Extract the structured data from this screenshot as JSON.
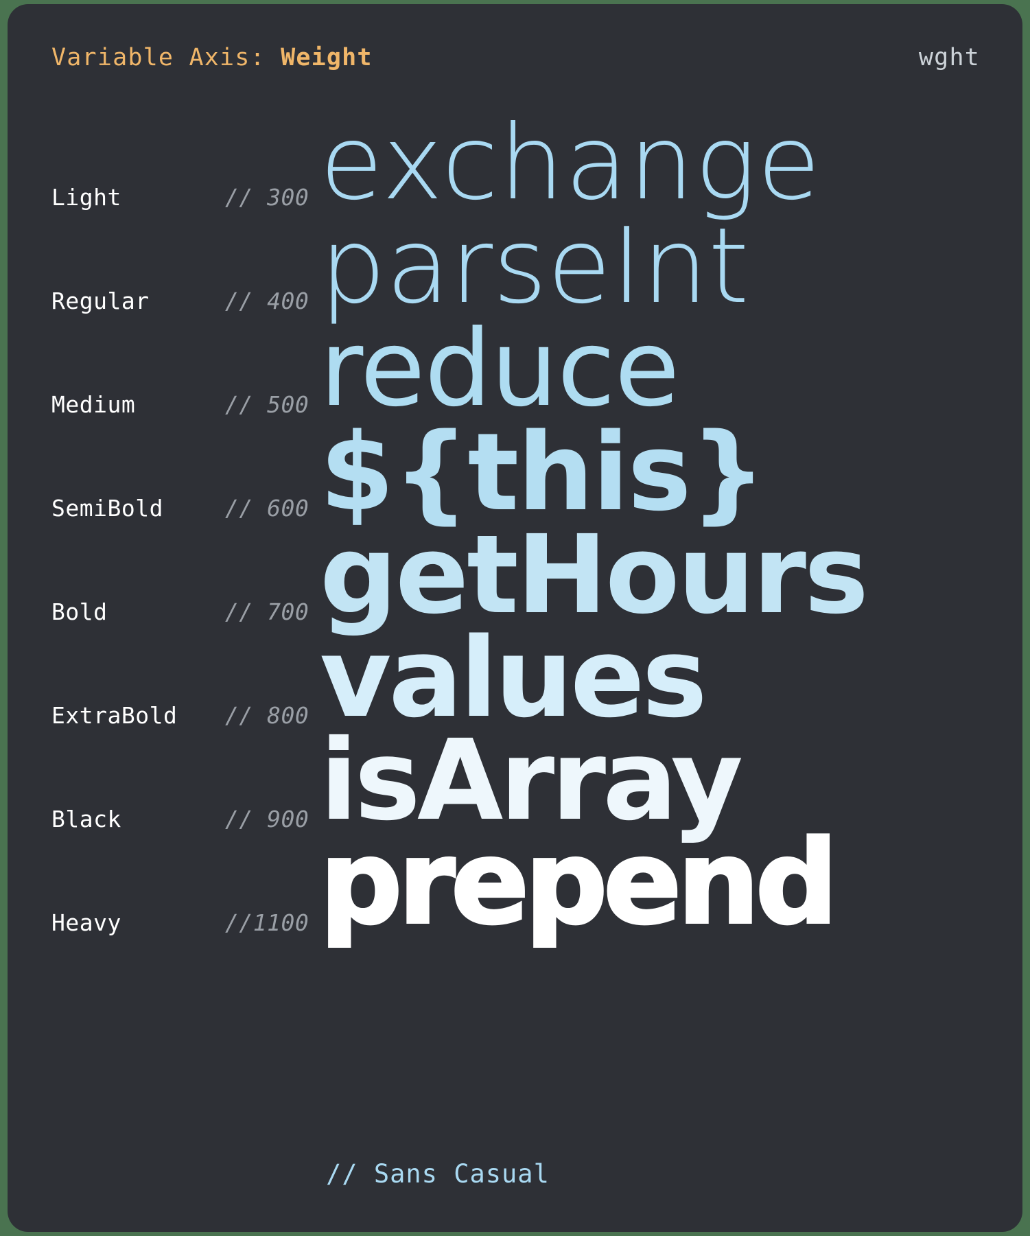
{
  "page": {
    "background_color": "#4a7350",
    "card_color": "#2e3036"
  },
  "header": {
    "title_prefix": "Variable Axis: ",
    "title_axis": "Weight",
    "axis_tag": "wght",
    "title_color": "#f0b669",
    "tag_color": "#ccd2d8"
  },
  "rows": [
    {
      "name": "Light",
      "comment": "// 300",
      "weight": 300,
      "sample": "exchange",
      "color": "#a9d9f2"
    },
    {
      "name": "Regular",
      "comment": "// 400",
      "weight": 400,
      "sample": "parseInt",
      "color": "#a9d9f2"
    },
    {
      "name": "Medium",
      "comment": "// 500",
      "weight": 500,
      "sample": "reduce",
      "color": "#aedcf1"
    },
    {
      "name": "SemiBold",
      "comment": "// 600",
      "weight": 600,
      "sample": "${this}",
      "color": "#b4def2"
    },
    {
      "name": "Bold",
      "comment": "// 700",
      "weight": 700,
      "sample": "getHours",
      "color": "#c2e4f4"
    },
    {
      "name": "ExtraBold",
      "comment": "// 800",
      "weight": 800,
      "sample": "values",
      "color": "#d6eefa"
    },
    {
      "name": "Black",
      "comment": "// 900",
      "weight": 900,
      "sample": "isArray",
      "color": "#eef7fc"
    },
    {
      "name": "Heavy",
      "comment": "//1100",
      "weight": 1100,
      "sample": "prepend",
      "color": "#ffffff"
    }
  ],
  "footer": {
    "caption": "// Sans Casual",
    "color": "#a9d9f2"
  }
}
